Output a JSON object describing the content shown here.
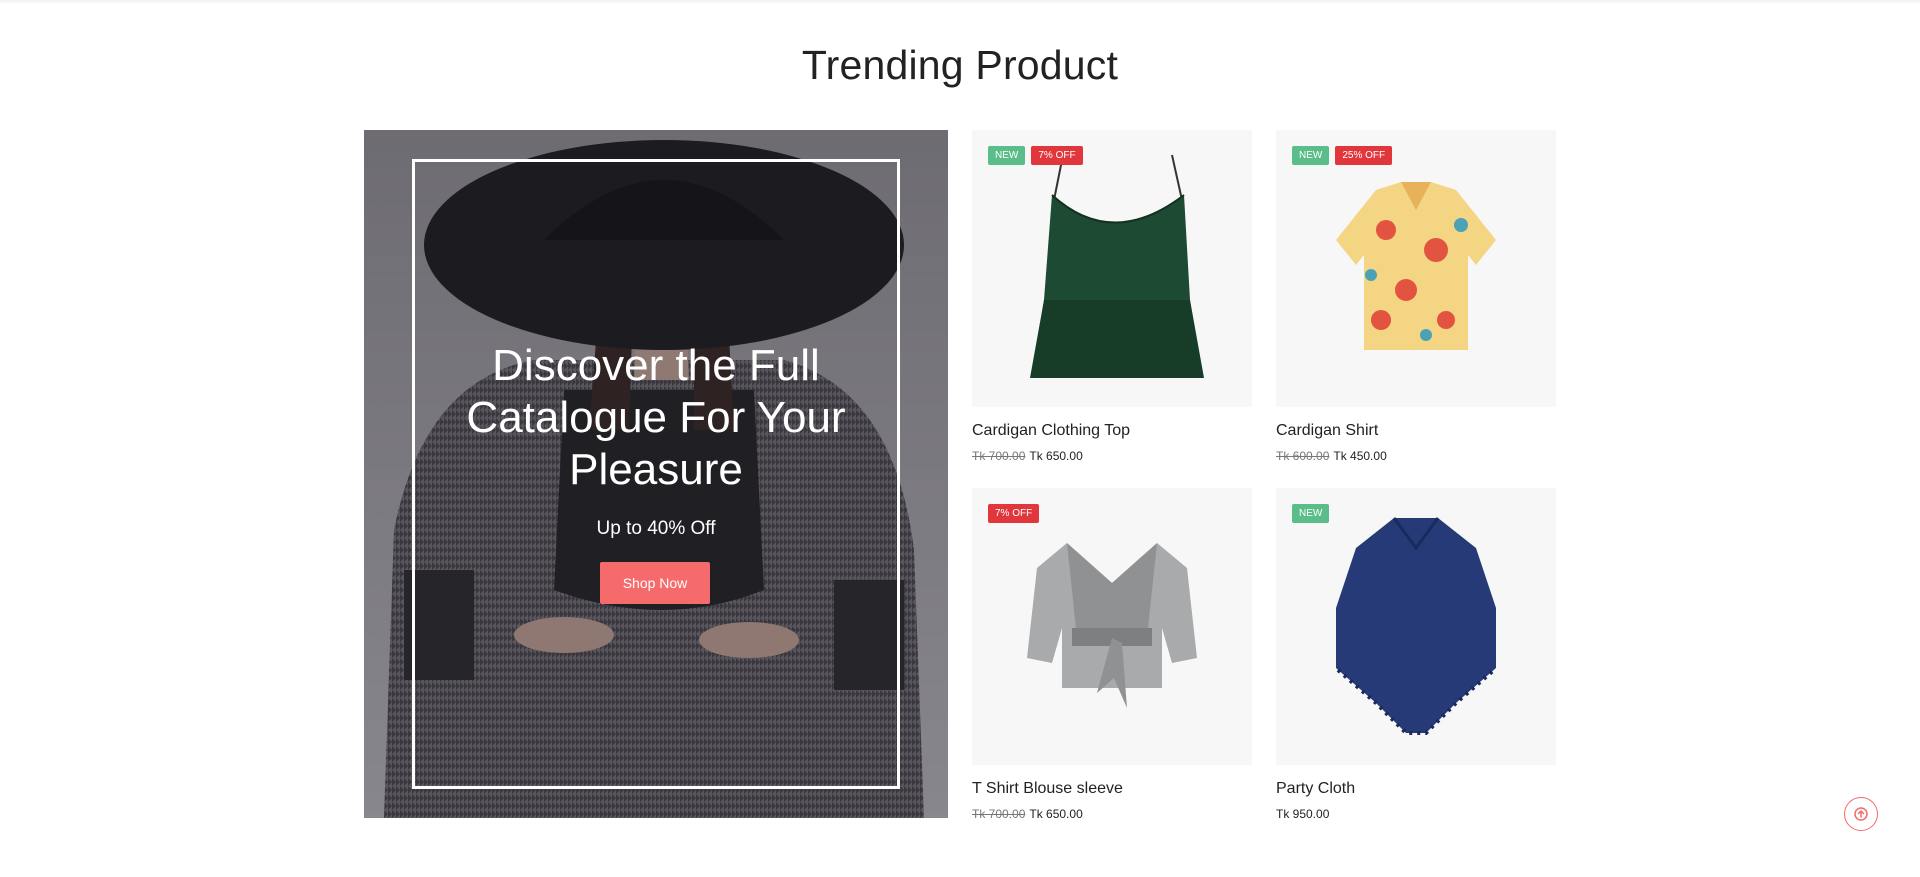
{
  "section": {
    "title": "Trending Product"
  },
  "banner": {
    "headline": "Discover the Full Catalogue For Your Pleasure",
    "subtitle": "Up to 40% Off",
    "cta_label": "Shop Now"
  },
  "products": [
    {
      "name": "Cardigan Clothing Top",
      "old_price": "Tk 700.00",
      "price": "Tk 650.00",
      "badges": {
        "new": "NEW",
        "off": "7% OFF"
      }
    },
    {
      "name": "Cardigan Shirt",
      "old_price": "Tk 600.00",
      "price": "Tk 450.00",
      "badges": {
        "new": "NEW",
        "off": "25% OFF"
      }
    },
    {
      "name": "T Shirt Blouse sleeve",
      "old_price": "Tk 700.00",
      "price": "Tk 650.00",
      "badges": {
        "off": "7% OFF"
      }
    },
    {
      "name": "Party Cloth",
      "price": "Tk 950.00",
      "badges": {
        "new": "NEW"
      }
    }
  ],
  "colors": {
    "accent": "#f56a6a",
    "badge_new": "#5bbd8a",
    "badge_off": "#e0363c"
  },
  "icons": {
    "scroll_top": "arrow-up-icon"
  }
}
